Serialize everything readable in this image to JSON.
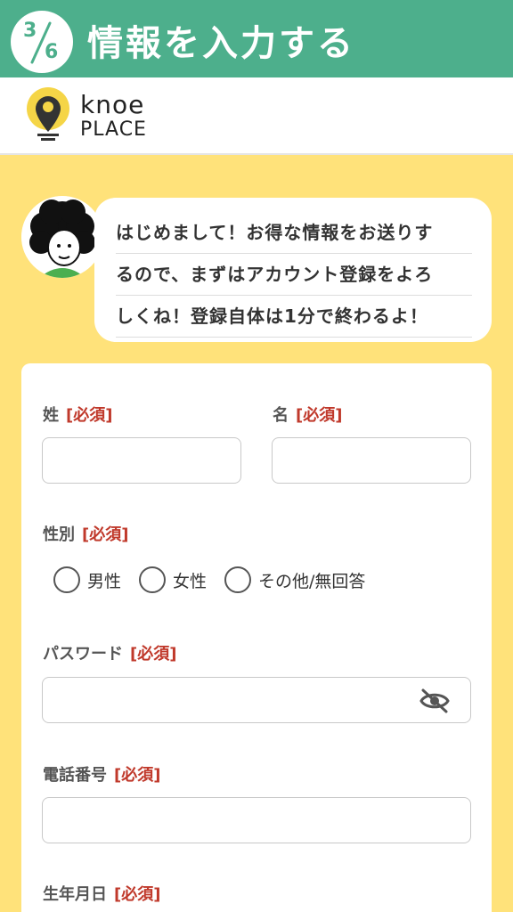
{
  "step": {
    "current": "3",
    "total": "6",
    "title": "情報を入力する"
  },
  "brand": {
    "line1": "knoe",
    "line2": "PLACE"
  },
  "bubble": {
    "lines": [
      "はじめまして！お得な情報をお送りす",
      "るので、まずはアカウント登録をよろ",
      "しくね！登録自体は1分で終わるよ！"
    ]
  },
  "form": {
    "required": "[必須]",
    "last_name_label": "姓",
    "first_name_label": "名",
    "gender_label": "性別",
    "gender_options": [
      "男性",
      "女性",
      "その他/無回答"
    ],
    "password_label": "パスワード",
    "phone_label": "電話番号",
    "birthdate_label": "生年月日"
  },
  "colors": {
    "banner": "#4daf8c",
    "background": "#ffe27a",
    "required": "#c0392b"
  },
  "icons": {
    "password_toggle": "eye-off-icon"
  }
}
